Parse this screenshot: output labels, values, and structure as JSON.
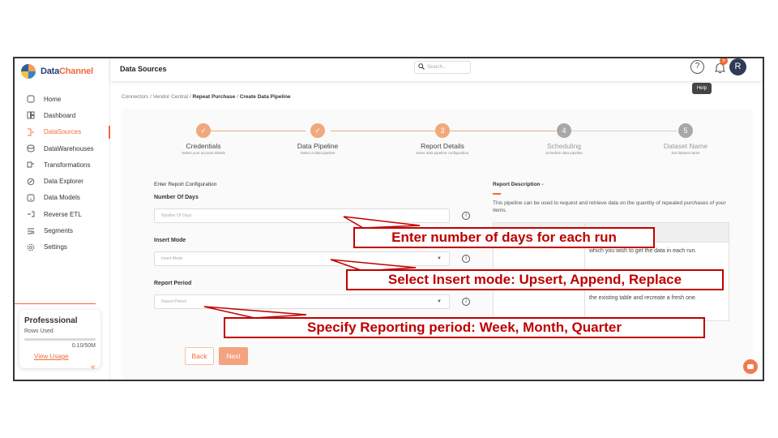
{
  "brand": {
    "name_a": "Data",
    "name_b": "Channel"
  },
  "sidebar": {
    "items": [
      {
        "label": "Home",
        "icon": "home-icon"
      },
      {
        "label": "Dashboard",
        "icon": "dashboard-icon"
      },
      {
        "label": "DataSources",
        "icon": "datasources-icon",
        "active": true
      },
      {
        "label": "DataWarehouses",
        "icon": "warehouse-icon"
      },
      {
        "label": "Transformations",
        "icon": "transform-icon"
      },
      {
        "label": "Data Explorer",
        "icon": "explorer-icon"
      },
      {
        "label": "Data Models",
        "icon": "models-icon"
      },
      {
        "label": "Reverse ETL",
        "icon": "reverse-etl-icon"
      },
      {
        "label": "Segments",
        "icon": "segments-icon"
      },
      {
        "label": "Settings",
        "icon": "settings-icon"
      }
    ],
    "plan": {
      "title": "Professsional",
      "rows_label": "Rows Used",
      "usage": "0.10/50M",
      "usage_fraction": 0.002,
      "link": "View Usage"
    },
    "collapse": "«"
  },
  "header": {
    "title": "Data Sources",
    "search_placeholder": "Search...",
    "notifications": "5",
    "avatar": "R",
    "help_tooltip": "Help"
  },
  "breadcrumb": {
    "c1": "Connectors",
    "c2": "Vendor Central",
    "c3": "Repeat Purchase",
    "c4": "Create Data Pipeline",
    "sep": "/"
  },
  "stepper": [
    {
      "num": "✓",
      "label": "Credentials",
      "sub": "Select your account details",
      "state": "done"
    },
    {
      "num": "✓",
      "label": "Data Pipeline",
      "sub": "Select a data pipeline",
      "state": "done"
    },
    {
      "num": "3",
      "label": "Report Details",
      "sub": "Enter data pipeline configuration",
      "state": "current"
    },
    {
      "num": "4",
      "label": "Scheduling",
      "sub": "Schedule data pipeline",
      "state": "pending"
    },
    {
      "num": "5",
      "label": "Dataset Name",
      "sub": "Set dataset name",
      "state": "pending"
    }
  ],
  "form": {
    "section_title": "Enter Report Configuration",
    "days_label": "Number Of Days",
    "days_placeholder": "Number Of Days",
    "insert_label": "Insert Mode",
    "insert_placeholder": "Insert Mode",
    "period_label": "Report Period",
    "period_placeholder": "Report Period",
    "info": "i",
    "back": "Back",
    "next": "Next"
  },
  "description": {
    "title": "Report Description -",
    "text": "This pipeline can be used to request and retrieve data on the quantity of repeated purchases of your items.",
    "row1": "which you wish to get the data in each run.",
    "row2": "the existing table and recreate a fresh one."
  },
  "callouts": {
    "days": "Enter number of days for each run",
    "insert": "Select Insert mode: Upsert, Append, Replace",
    "period": "Specify Reporting period: Week, Month, Quarter"
  },
  "colors": {
    "accent": "#ef6c3a",
    "callout": "#c00000"
  }
}
